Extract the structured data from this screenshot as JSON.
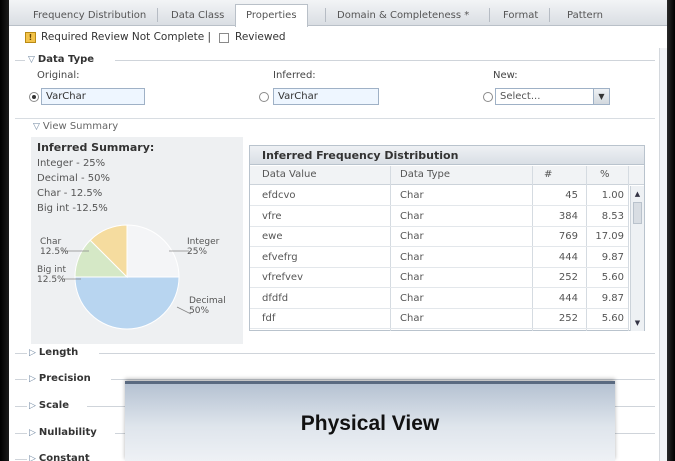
{
  "tabs": [
    {
      "label": "Frequency Distribution",
      "active": false
    },
    {
      "label": "Data Class",
      "active": false
    },
    {
      "label": "Properties",
      "active": true
    },
    {
      "label": "Domain & Completeness *",
      "active": false
    },
    {
      "label": "Format",
      "active": false
    },
    {
      "label": "Pattern",
      "active": false
    }
  ],
  "review": {
    "status_text": "Required Review Not Complete |",
    "checkbox_label": "Reviewed",
    "checked": false
  },
  "data_type": {
    "title": "Data Type",
    "original": {
      "label": "Original:",
      "value": "VarChar",
      "selected": true
    },
    "inferred": {
      "label": "Inferred:",
      "value": "VarChar",
      "selected": false
    },
    "new": {
      "label": "New:",
      "placeholder": "Select...",
      "selected": false
    }
  },
  "view_summary": {
    "label": "View Summary",
    "inferred_summary": {
      "title": "Inferred Summary:",
      "lines": [
        "Integer - 25%",
        "Decimal - 50%",
        "Char - 12.5%",
        "Big int -12.5%"
      ]
    }
  },
  "chart_data": {
    "type": "pie",
    "title": "",
    "slices": [
      {
        "label": "Integer",
        "value": 25,
        "display": "25%",
        "color": "#f4f5f7"
      },
      {
        "label": "Decimal",
        "value": 50,
        "display": "50%",
        "color": "#b8d5f0"
      },
      {
        "label": "Big int",
        "value": 12.5,
        "display": "12.5%",
        "color": "#d5e8c6"
      },
      {
        "label": "Char",
        "value": 12.5,
        "display": "12.5%",
        "color": "#f5dc9f"
      }
    ]
  },
  "frequency": {
    "title": "Inferred Frequency Distribution",
    "columns": [
      "Data Value",
      "Data Type",
      "#",
      "%"
    ],
    "rows": [
      [
        "efdcvo",
        "Char",
        "45",
        "1.00"
      ],
      [
        "vfre",
        "Char",
        "384",
        "8.53"
      ],
      [
        "ewe",
        "Char",
        "769",
        "17.09"
      ],
      [
        "efvefrg",
        "Char",
        "444",
        "9.87"
      ],
      [
        "vfrefvev",
        "Char",
        "252",
        "5.60"
      ],
      [
        "dfdfd",
        "Char",
        "444",
        "9.87"
      ],
      [
        "fdf",
        "Char",
        "252",
        "5.60"
      ]
    ]
  },
  "sections": [
    "Length",
    "Precision",
    "Scale",
    "Nullability",
    "Constant"
  ],
  "overlay": {
    "caption": "Physical View"
  },
  "colors": {
    "accent": "#6f86a0",
    "tab_border": "#b9c0c8"
  }
}
